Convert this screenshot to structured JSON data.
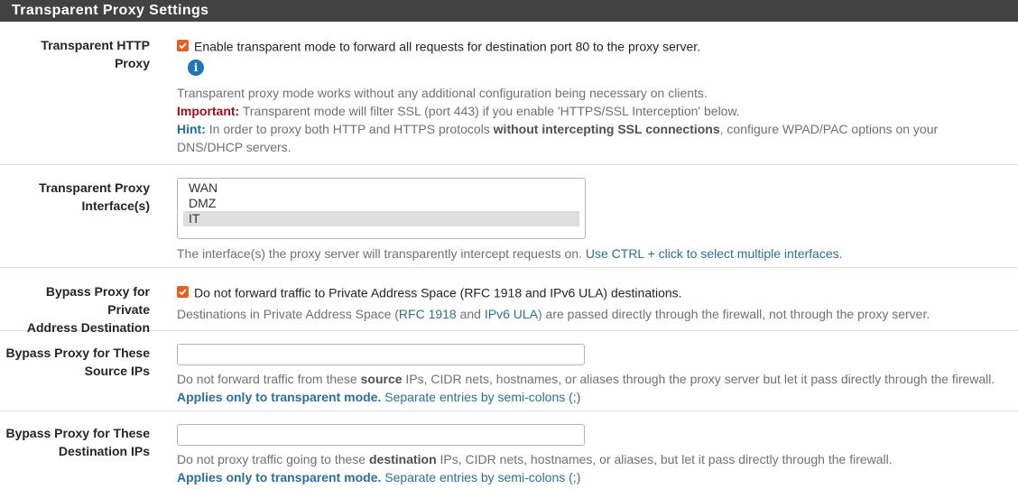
{
  "header": {
    "title": "Transparent Proxy Settings"
  },
  "http_proxy": {
    "label": "Transparent HTTP Proxy",
    "checked": true,
    "checkbox_text": "Enable transparent mode to forward all requests for destination port 80 to the proxy server.",
    "help_line1": "Transparent proxy mode works without any additional configuration being necessary on clients.",
    "important_label": "Important:",
    "important_text": " Transparent mode will filter SSL (port 443) if you enable 'HTTPS/SSL Interception' below.",
    "hint_label": "Hint:",
    "hint_text1": " In order to proxy both HTTP and HTTPS protocols ",
    "hint_strong": "without intercepting SSL connections",
    "hint_text2": ", configure WPAD/PAC options on your DNS/DHCP servers."
  },
  "interfaces": {
    "label_line1": "Transparent Proxy",
    "label_line2": "Interface(s)",
    "options": [
      "WAN",
      "DMZ",
      "IT"
    ],
    "selected": "IT",
    "help_text": "The interface(s) the proxy server will transparently intercept requests on. ",
    "help_link": "Use CTRL + click to select multiple interfaces."
  },
  "bypass_private": {
    "label_line1": "Bypass Proxy for Private",
    "label_line2": "Address Destination",
    "checked": true,
    "checkbox_text": "Do not forward traffic to Private Address Space (RFC 1918 and IPv6 ULA) destinations.",
    "help_a": "Destinations in Private Address Space (",
    "link_rfc": "RFC 1918",
    "help_and": " and ",
    "link_ula": "IPv6 ULA",
    "help_b": ") are passed directly through the firewall, not through the proxy server."
  },
  "bypass_source": {
    "label_line1": "Bypass Proxy for These",
    "label_line2": "Source IPs",
    "value": "",
    "help_a": "Do not forward traffic from these ",
    "help_strong": "source",
    "help_b": " IPs, CIDR nets, hostnames, or aliases through the proxy server but let it pass directly through the firewall.",
    "applies": "Applies only to transparent mode.",
    "separate": " Separate entries by semi-colons (;)"
  },
  "bypass_dest": {
    "label_line1": "Bypass Proxy for These",
    "label_line2": "Destination IPs",
    "value": "",
    "help_a": "Do not proxy traffic going to these ",
    "help_strong": "destination",
    "help_b": " IPs, CIDR nets, hostnames, or aliases, but let it pass directly through the firewall.",
    "applies": "Applies only to transparent mode.",
    "separate": " Separate entries by semi-colons (;)"
  }
}
